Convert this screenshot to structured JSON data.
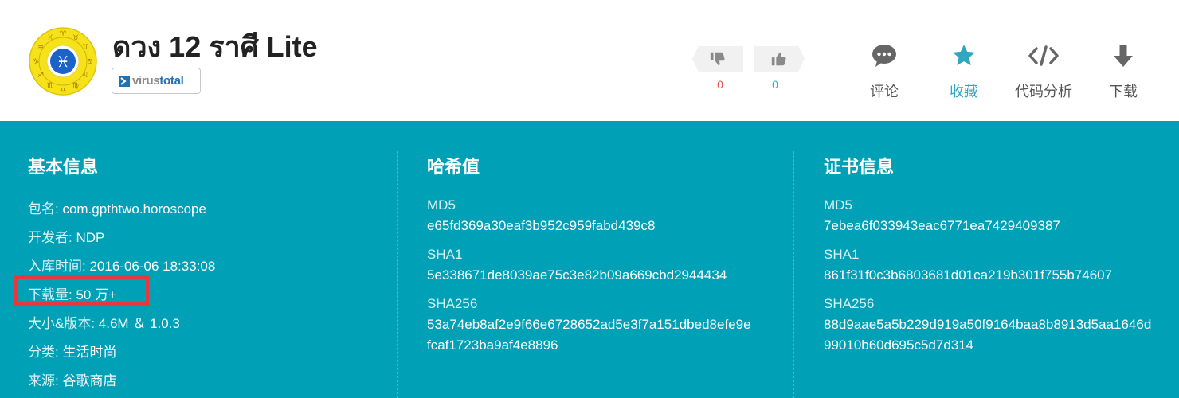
{
  "app": {
    "title": "ดวง 12 ราศี Lite",
    "badge": {
      "part1": "virus",
      "part2": "total"
    }
  },
  "votes": {
    "down_count": "0",
    "up_count": "0"
  },
  "actions": [
    {
      "label": "评论",
      "icon": "comment-icon"
    },
    {
      "label": "收藏",
      "icon": "star-icon",
      "active": true
    },
    {
      "label": "代码分析",
      "icon": "code-icon"
    },
    {
      "label": "下载",
      "icon": "download-icon"
    }
  ],
  "colors": {
    "panel_bg": "#00a0b6",
    "accent": "#2ea7bf",
    "downvote": "#e0544f",
    "highlight": "#e8373f"
  },
  "basic_info": {
    "title": "基本信息",
    "rows": [
      {
        "label": "包名:",
        "value": "com.gpthtwo.horoscope"
      },
      {
        "label": "开发者:",
        "value": "NDP"
      },
      {
        "label": "入库时间:",
        "value": "2016-06-06 18:33:08"
      },
      {
        "label": "下载量:",
        "value": "50 万+"
      },
      {
        "label": "大小&版本:",
        "value": "4.6M ＆ 1.0.3"
      },
      {
        "label": "分类:",
        "value": "生活时尚"
      },
      {
        "label": "来源:",
        "value": "谷歌商店"
      }
    ]
  },
  "hash_values": {
    "title": "哈希值",
    "md5_label": "MD5",
    "md5": "e65fd369a30eaf3b952c959fabd439c8",
    "sha1_label": "SHA1",
    "sha1": "5e338671de8039ae75c3e82b09a669cbd2944434",
    "sha256_label": "SHA256",
    "sha256_line1": "53a74eb8af2e9f66e6728652ad5e3f7a151dbed8efe9e",
    "sha256_line2": "fcaf1723ba9af4e8896"
  },
  "certificate": {
    "title": "证书信息",
    "md5_label": "MD5",
    "md5": "7ebea6f033943eac6771ea7429409387",
    "sha1_label": "SHA1",
    "sha1": "861f31f0c3b6803681d01ca219b301f755b74607",
    "sha256_label": "SHA256",
    "sha256_line1": "88d9aae5a5b229d919a50f9164baa8b8913d5aa1646d",
    "sha256_line2": "99010b60d695c5d7d314"
  }
}
